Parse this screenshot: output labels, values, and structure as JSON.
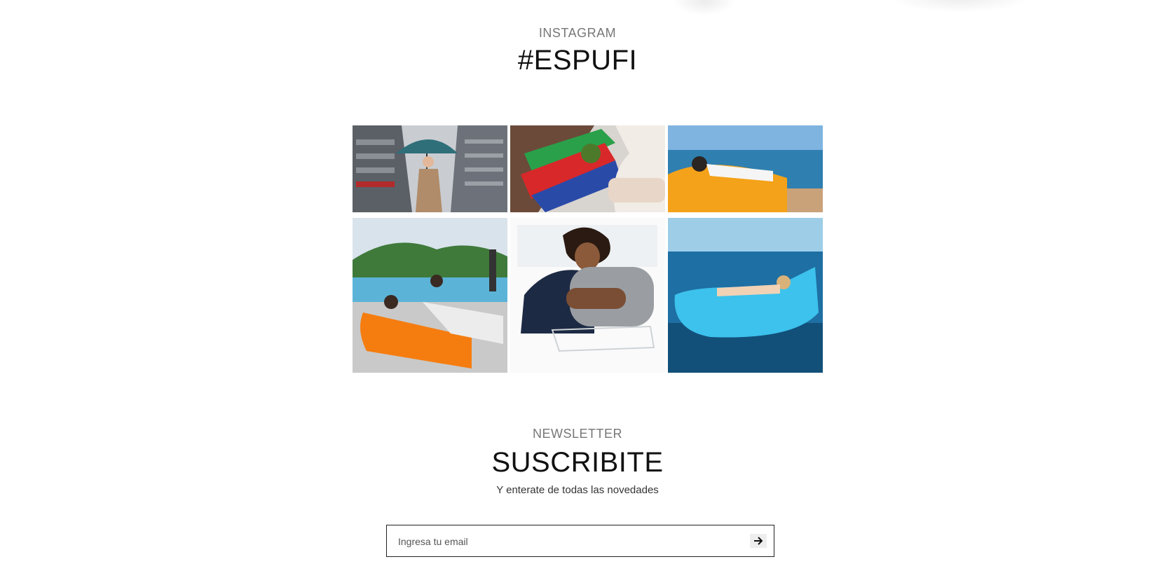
{
  "instagram": {
    "kicker": "INSTAGRAM",
    "heading": "#ESPUFI"
  },
  "gallery": {
    "items": [
      {
        "subject": "woman with umbrella between buildings"
      },
      {
        "subject": "car organizer with plants"
      },
      {
        "subject": "person lying on yellow inflatable lounger by sea"
      },
      {
        "subject": "people on orange and white inflatable loungers by pool"
      },
      {
        "subject": "woman resting on grey inflatable travel pillow"
      },
      {
        "subject": "woman on blue inflatable lounger in sea"
      }
    ]
  },
  "newsletter": {
    "kicker": "NEWSLETTER",
    "heading": "SUSCRIBITE",
    "subtitle": "Y enterate de todas las novedades",
    "email_placeholder": "Ingresa tu email",
    "email_value": "",
    "submit_icon": "arrow-right-icon"
  },
  "colors": {
    "heading": "#111111",
    "kicker": "#777777",
    "border": "#222222"
  }
}
